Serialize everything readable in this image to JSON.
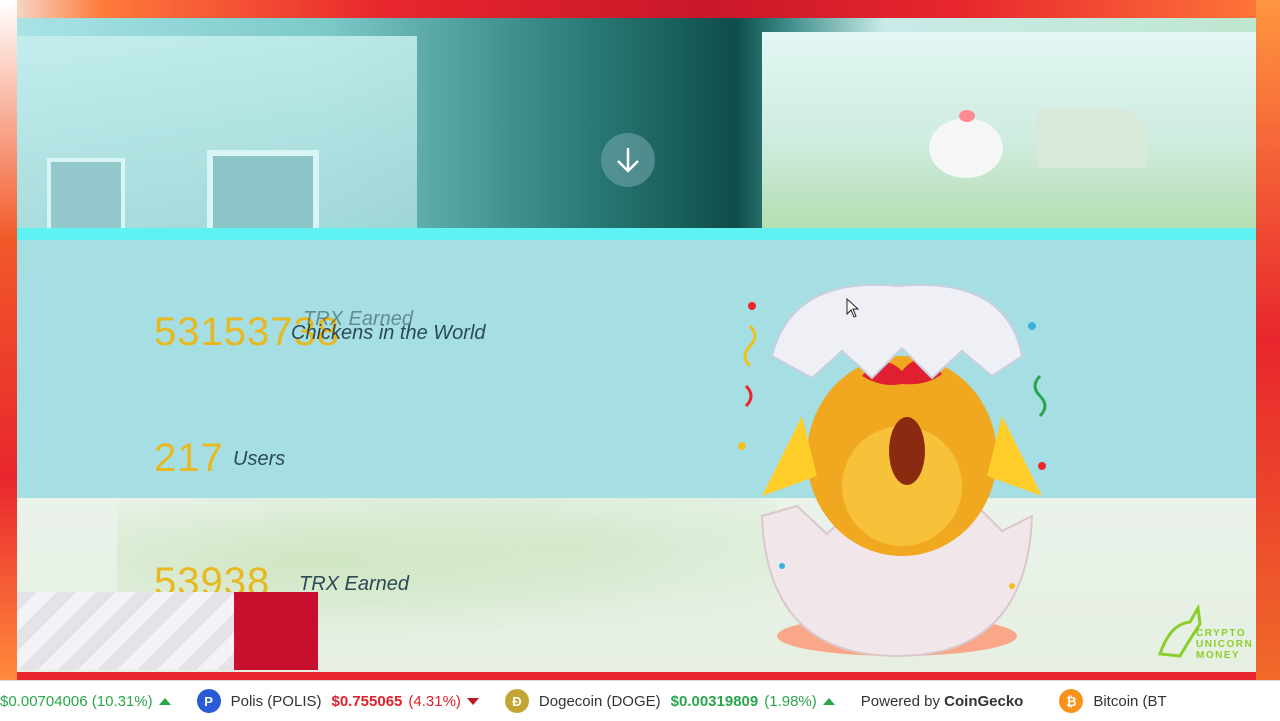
{
  "hero": {
    "scroll_icon": "arrow-down-icon"
  },
  "stats": [
    {
      "value": "53153738",
      "label": "Chickens in the World"
    },
    {
      "value": "217",
      "label": "Users"
    },
    {
      "value": "53938",
      "label": "TRX Earned"
    }
  ],
  "ghost_label": "TRX Earned",
  "logo": {
    "line1": "CRYPTO",
    "line2": "UNICORN",
    "line3": "MONEY"
  },
  "ticker": {
    "items": [
      {
        "text": "$0.00704006 (10.31%)",
        "trend": "up"
      },
      {
        "icon": "P",
        "name": "Polis (POLIS)",
        "price": "$0.755065",
        "change": "(4.31%)",
        "trend": "down",
        "color": "#2a5bd7"
      },
      {
        "icon": "Ð",
        "name": "Dogecoin (DOGE)",
        "price": "$0.00319809",
        "change": "(1.98%)",
        "trend": "up",
        "color": "#c2a633"
      },
      {
        "icon": "₿",
        "name": "Bitcoin (BT",
        "color": "#f7931a"
      }
    ],
    "powered_by": "Powered by",
    "powered_brand": "CoinGecko"
  },
  "colors": {
    "frame": "#e8262d",
    "number": "#e8b820",
    "cyan": "#5ff2f3"
  }
}
